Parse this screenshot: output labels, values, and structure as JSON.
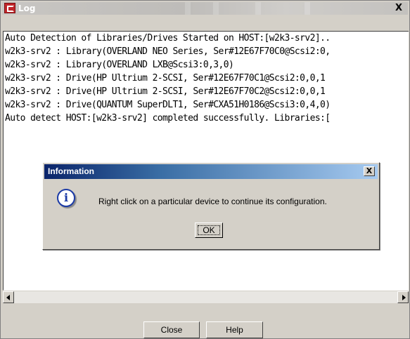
{
  "window": {
    "title": "Log",
    "close_glyph": "X",
    "icon": "app-logo-icon"
  },
  "log": {
    "lines": [
      "Auto Detection of Libraries/Drives Started on HOST:[w2k3-srv2]..",
      "w2k3-srv2 : Library(OVERLAND NEO Series, Ser#12E67F70C0@Scsi2:0,",
      "w2k3-srv2 : Library(OVERLAND LXB@Scsi3:0,3,0)",
      "w2k3-srv2 : Drive(HP Ultrium 2-SCSI, Ser#12E67F70C1@Scsi2:0,0,1",
      "w2k3-srv2 : Drive(HP Ultrium 2-SCSI, Ser#12E67F70C2@Scsi2:0,0,1",
      "w2k3-srv2 : Drive(QUANTUM SuperDLT1, Ser#CXA51H0186@Scsi3:0,4,0)",
      "Auto detect HOST:[w2k3-srv2] completed successfully. Libraries:["
    ]
  },
  "buttons": {
    "close": "Close",
    "help": "Help"
  },
  "dialog": {
    "title": "Information",
    "close_glyph": "X",
    "icon": "info-icon",
    "icon_glyph": "i",
    "message": "Right click on a particular device to continue its configuration.",
    "ok": "OK"
  },
  "colors": {
    "dialog_title_start": "#0a246a",
    "dialog_title_end": "#a6caf0",
    "window_bg": "#d4d0c8"
  }
}
